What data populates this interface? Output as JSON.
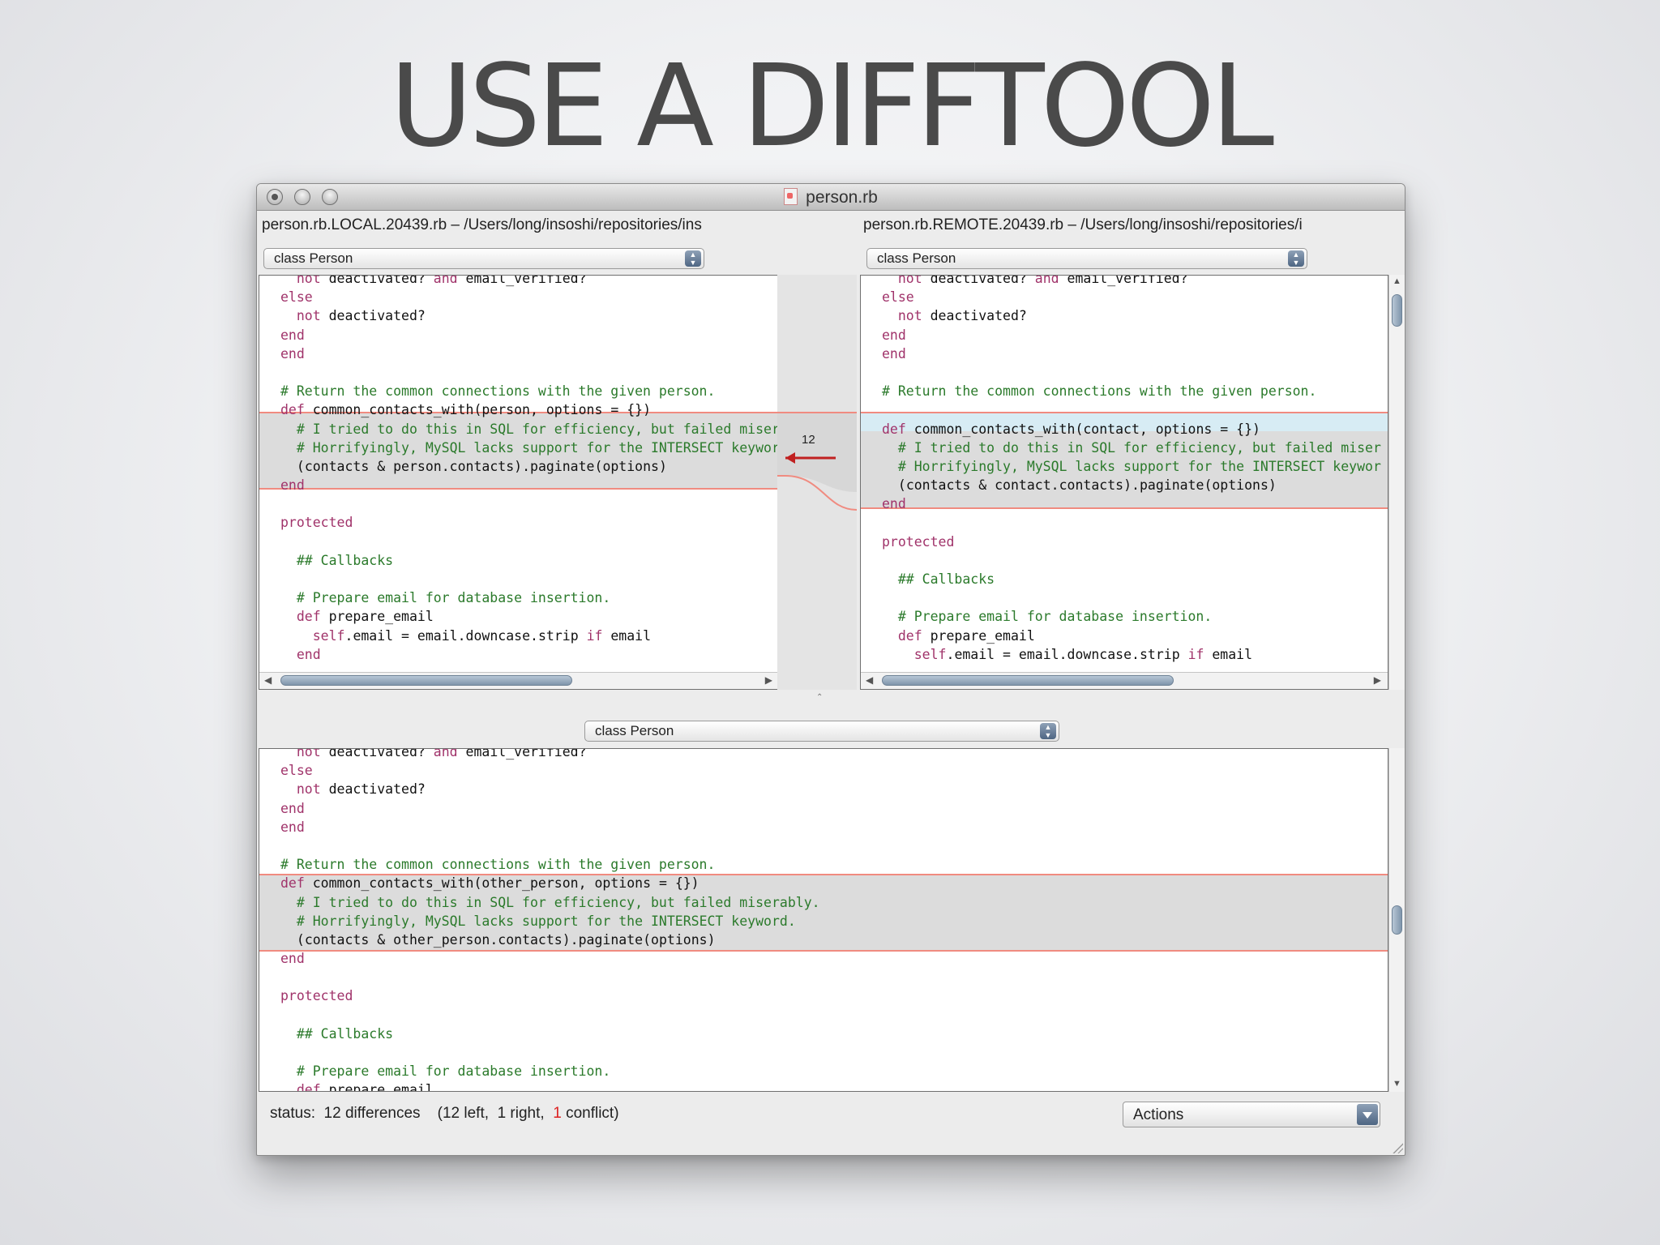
{
  "slide": {
    "title": "USE A DIFFTOOL"
  },
  "window": {
    "title": "person.rb"
  },
  "left_panel": {
    "path": "person.rb.LOCAL.20439.rb – /Users/long/insoshi/repositories/ins",
    "popup": "class Person",
    "lines": [
      "  not deactivated? and email_verified?",
      "else",
      "  not deactivated?",
      "end",
      "end",
      "",
      "# Return the common connections with the given person.",
      "def common_contacts_with(person, options = {})",
      "  # I tried to do this in SQL for efficiency, but failed miser",
      "  # Horrifyingly, MySQL lacks support for the INTERSECT keywor",
      "  (contacts & person.contacts).paginate(options)",
      "end",
      "",
      "protected",
      "",
      "  ## Callbacks",
      "",
      "  # Prepare email for database insertion.",
      "  def prepare_email",
      "    self.email = email.downcase.strip if email",
      "  end"
    ]
  },
  "right_panel": {
    "path": "person.rb.REMOTE.20439.rb – /Users/long/insoshi/repositories/i",
    "popup": "class Person",
    "lines": [
      "  not deactivated? and email_verified?",
      "else",
      "  not deactivated?",
      "end",
      "end",
      "",
      "# Return the common connections with the given person.",
      "",
      "def common_contacts_with(contact, options = {})",
      "  # I tried to do this in SQL for efficiency, but failed miser",
      "  # Horrifyingly, MySQL lacks support for the INTERSECT keywor",
      "  (contacts & contact.contacts).paginate(options)",
      "end",
      "",
      "protected",
      "",
      "  ## Callbacks",
      "",
      "  # Prepare email for database insertion.",
      "  def prepare_email",
      "    self.email = email.downcase.strip if email"
    ]
  },
  "merge_panel": {
    "popup": "class Person",
    "lines": [
      "  not deactivated? and email_verified?",
      "else",
      "  not deactivated?",
      "end",
      "end",
      "",
      "# Return the common connections with the given person.",
      "def common_contacts_with(other_person, options = {})",
      "  # I tried to do this in SQL for efficiency, but failed miserably.",
      "  # Horrifyingly, MySQL lacks support for the INTERSECT keyword.",
      "  (contacts & other_person.contacts).paginate(options)",
      "end",
      "",
      "protected",
      "",
      "  ## Callbacks",
      "",
      "  # Prepare email for database insertion.",
      "  def prepare_email"
    ]
  },
  "diff_marker": {
    "number": "12"
  },
  "status": {
    "prefix": "status:  12 differences    (12 left,  1 right,  ",
    "conflict_count": "1",
    "suffix": " conflict)"
  },
  "actions": {
    "label": "Actions"
  },
  "colors": {
    "conflict_red": "#dd2222",
    "diff_border": "#f08b80",
    "keyword": "#a0336a",
    "comment": "#2b7a2b"
  }
}
